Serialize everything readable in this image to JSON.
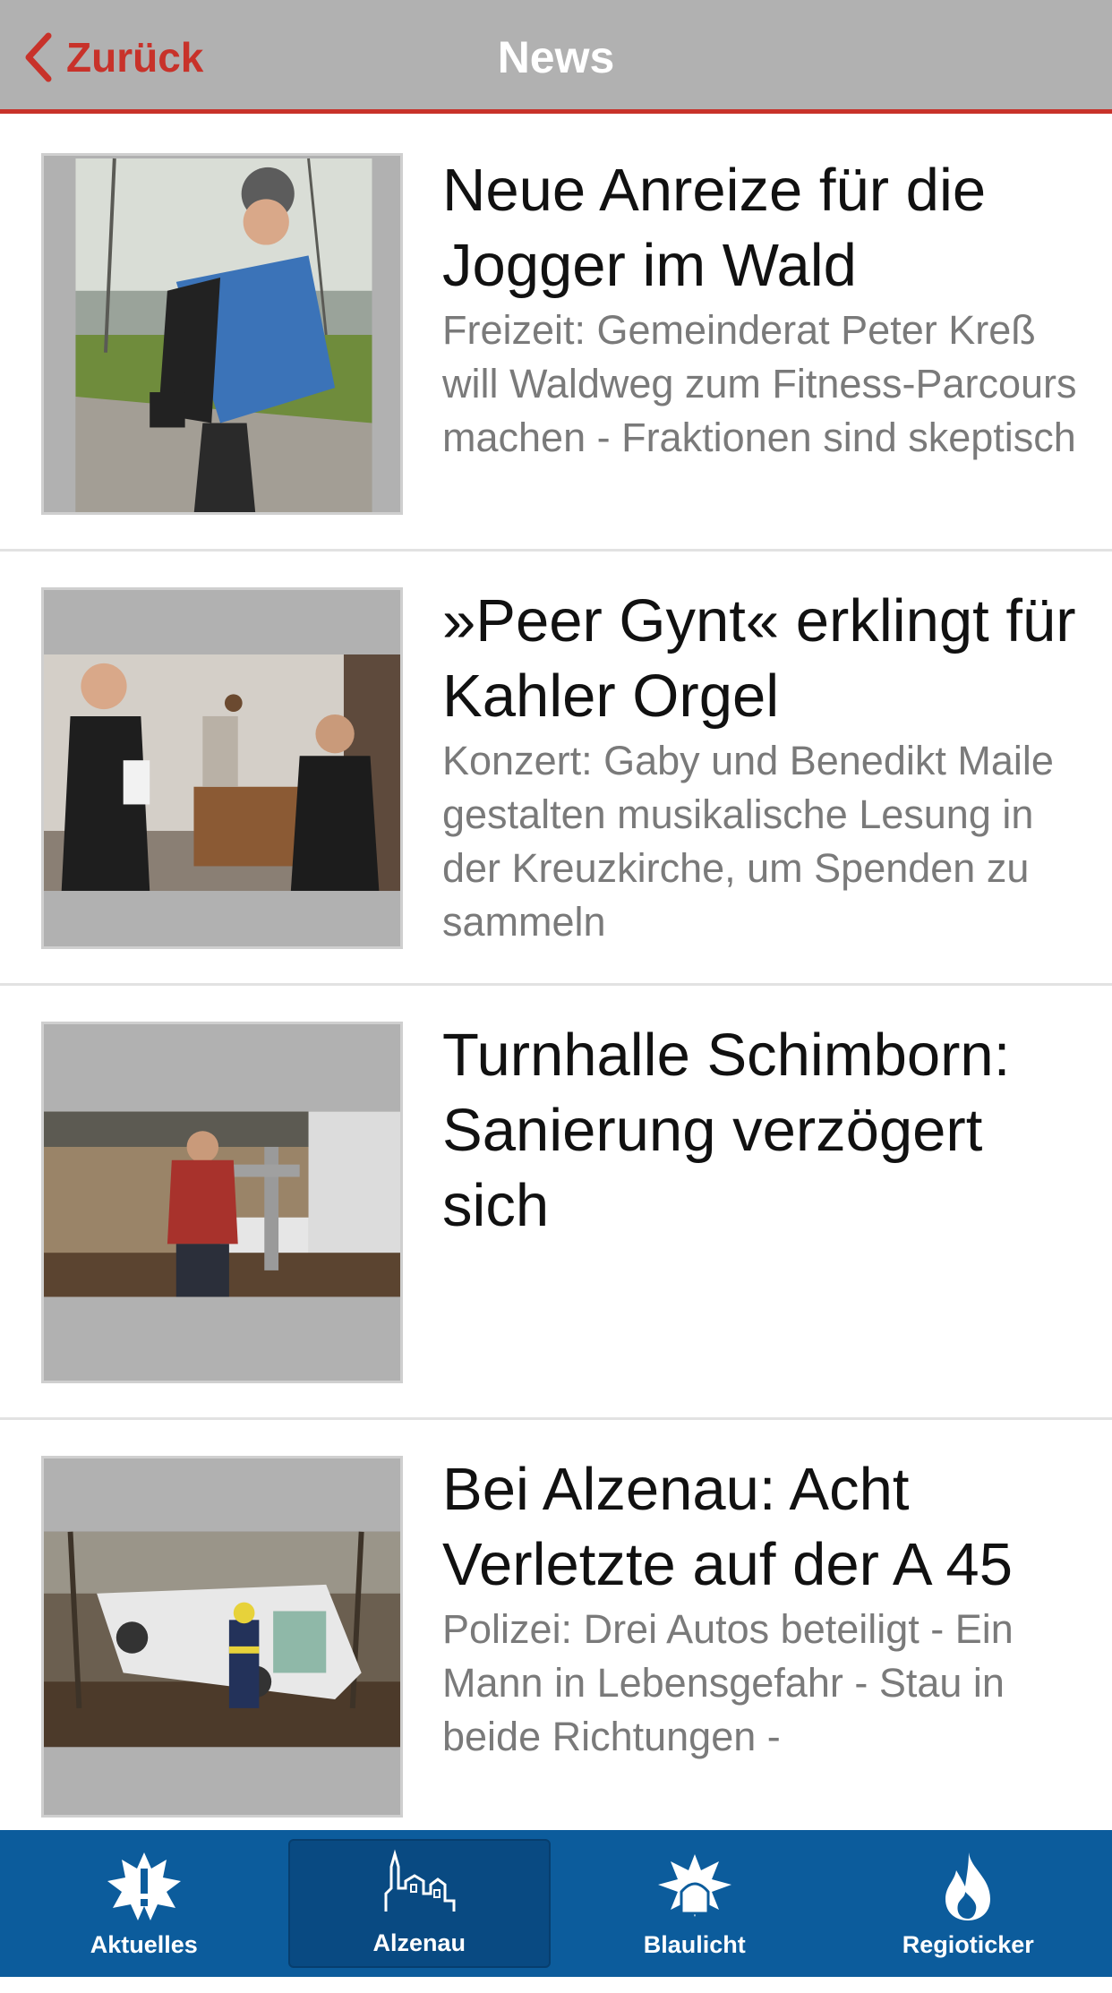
{
  "header": {
    "back_label": "Zurück",
    "title": "News"
  },
  "articles": [
    {
      "headline": "Neue Anreize für die Jogger im Wald",
      "summary": "Freizeit: Gemeinderat Peter Kreß will Waldweg zum Fitness-Parcours machen - Fraktionen sind skeptisch"
    },
    {
      "headline": "»Peer Gynt« erklingt für Kahler Orgel",
      "summary": "Konzert: Gaby und Benedikt Maile gestalten musikalische Lesung in der Kreuzkirche, um Spenden zu sammeln"
    },
    {
      "headline": "Turnhalle Schimborn: Sanierung verzögert sich",
      "summary": ""
    },
    {
      "headline": "Bei Alzenau: Acht Verletzte auf der A 45",
      "summary": "Polizei: Drei Autos beteiligt - Ein Mann in Lebensgefahr - Stau in beide Richtungen -"
    }
  ],
  "tabbar": {
    "tabs": [
      {
        "label": "Aktuelles",
        "icon": "alert-burst-icon",
        "active": false
      },
      {
        "label": "Alzenau",
        "icon": "town-skyline-icon",
        "active": true
      },
      {
        "label": "Blaulicht",
        "icon": "siren-icon",
        "active": false
      },
      {
        "label": "Regioticker",
        "icon": "flame-icon",
        "active": false
      }
    ]
  },
  "colors": {
    "header_bg": "#b1b1b1",
    "accent_red": "#c8322a",
    "tabbar_bg": "#0c5c9c",
    "tab_active_bg": "#094a82"
  }
}
